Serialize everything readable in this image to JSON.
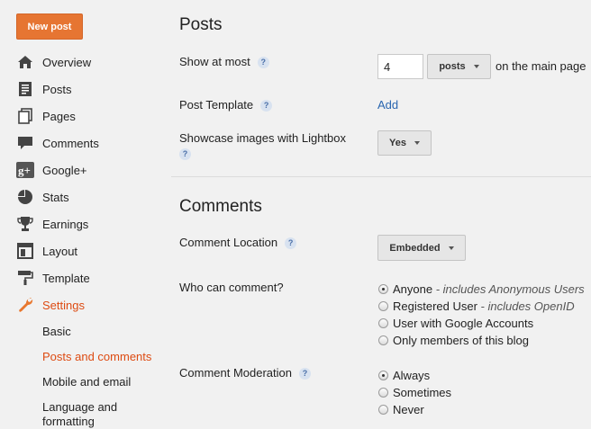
{
  "sidebar": {
    "new_post_label": "New post",
    "items": [
      {
        "label": "Overview",
        "icon": "home-icon"
      },
      {
        "label": "Posts",
        "icon": "posts-icon"
      },
      {
        "label": "Pages",
        "icon": "pages-icon"
      },
      {
        "label": "Comments",
        "icon": "comments-icon"
      },
      {
        "label": "Google+",
        "icon": "google-plus-icon"
      },
      {
        "label": "Stats",
        "icon": "stats-icon"
      },
      {
        "label": "Earnings",
        "icon": "trophy-icon"
      },
      {
        "label": "Layout",
        "icon": "layout-icon"
      },
      {
        "label": "Template",
        "icon": "paint-roller-icon"
      },
      {
        "label": "Settings",
        "icon": "wrench-icon",
        "active": true
      }
    ],
    "settings_subitems": [
      {
        "label": "Basic"
      },
      {
        "label": "Posts and comments",
        "active": true
      },
      {
        "label": "Mobile and email"
      },
      {
        "label": "Language and formatting"
      }
    ],
    "active_color": "#dd4b12",
    "new_post_color": "#e67532"
  },
  "posts_section": {
    "title": "Posts",
    "show_at_most": {
      "label": "Show at most",
      "value": "4",
      "unit": "posts",
      "suffix": "on the main page"
    },
    "post_template": {
      "label": "Post Template",
      "action": "Add"
    },
    "lightbox": {
      "label": "Showcase images with Lightbox",
      "value": "Yes"
    }
  },
  "comments_section": {
    "title": "Comments",
    "location": {
      "label": "Comment Location",
      "value": "Embedded"
    },
    "who": {
      "label": "Who can comment?",
      "options": [
        {
          "label": "Anyone",
          "note": " - includes Anonymous Users",
          "checked": true
        },
        {
          "label": "Registered User",
          "note": " - includes OpenID",
          "checked": false
        },
        {
          "label": "User with Google Accounts",
          "note": "",
          "checked": false
        },
        {
          "label": "Only members of this blog",
          "note": "",
          "checked": false
        }
      ]
    },
    "moderation": {
      "label": "Comment Moderation",
      "options": [
        {
          "label": "Always",
          "checked": true
        },
        {
          "label": "Sometimes",
          "checked": false
        },
        {
          "label": "Never",
          "checked": false
        }
      ]
    }
  },
  "help_glyph": "?"
}
